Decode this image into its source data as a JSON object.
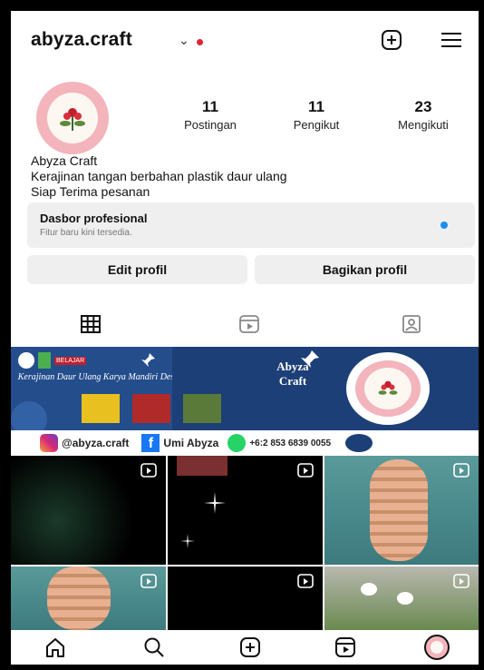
{
  "header": {
    "username": "abyza.craft",
    "chevron_icon": "chevron-down-icon",
    "add_icon": "plus-square-icon",
    "menu_icon": "hamburger-menu-icon"
  },
  "stats": [
    {
      "value": "11",
      "label": "Postingan"
    },
    {
      "value": "11",
      "label": "Pengikut"
    },
    {
      "value": "23",
      "label": "Mengikuti"
    }
  ],
  "bio": {
    "name": "Abyza Craft",
    "line1": "Kerajinan tangan berbahan plastik daur ulang",
    "line2": "Siap Terima pesanan"
  },
  "dashboard": {
    "title": "Dasbor profesional",
    "subtitle": "Fitur baru kini tersedia."
  },
  "buttons": {
    "edit": "Edit profil",
    "share": "Bagikan profil"
  },
  "tabs": [
    "grid-icon",
    "reels-icon",
    "tagged-icon"
  ],
  "banner": {
    "left_text": "Kerajinan Daur Ulang Karya Mandiri Desa Batu menyan",
    "mid_line1": "Abyza",
    "mid_line2": "Craft",
    "badge_text": "BELAJAR",
    "instagram": "@abyza.craft",
    "facebook": "Umi Abyza",
    "whatsapp": "+6:2 853 6839 0055"
  },
  "nav": [
    "home-icon",
    "search-icon",
    "create-icon",
    "reels-icon",
    "profile-avatar"
  ],
  "colors": {
    "accent_blue": "#1d8ef0",
    "notification_red": "#e0243a",
    "banner_blue": "#1d3f77"
  }
}
